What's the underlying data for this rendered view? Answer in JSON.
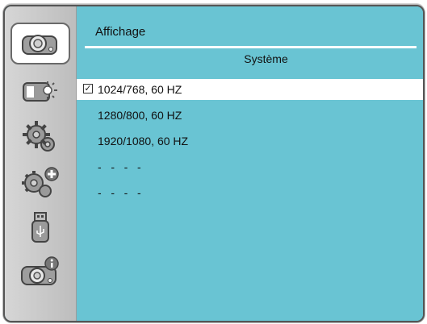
{
  "sidebar": {
    "items": [
      {
        "icon": "projector-icon",
        "selected": true
      },
      {
        "icon": "display-brightness-icon",
        "selected": false
      },
      {
        "icon": "gear-icon",
        "selected": false
      },
      {
        "icon": "gear-plus-icon",
        "selected": false
      },
      {
        "icon": "usb-drive-icon",
        "selected": false
      },
      {
        "icon": "projector-info-icon",
        "selected": false
      }
    ]
  },
  "header": {
    "title": "Affichage",
    "section": "Système"
  },
  "resolutions": [
    {
      "label": "1024/768, 60 HZ",
      "checked": true
    },
    {
      "label": "1280/800, 60 HZ",
      "checked": false
    },
    {
      "label": "1920/1080, 60 HZ",
      "checked": false
    },
    {
      "label": "-   -   -   -",
      "checked": false
    },
    {
      "label": "-   -   -   -",
      "checked": false
    }
  ],
  "colors": {
    "panel": "#69c4d3",
    "sidebar": "#c8c8c8",
    "highlight": "#ffffff"
  }
}
